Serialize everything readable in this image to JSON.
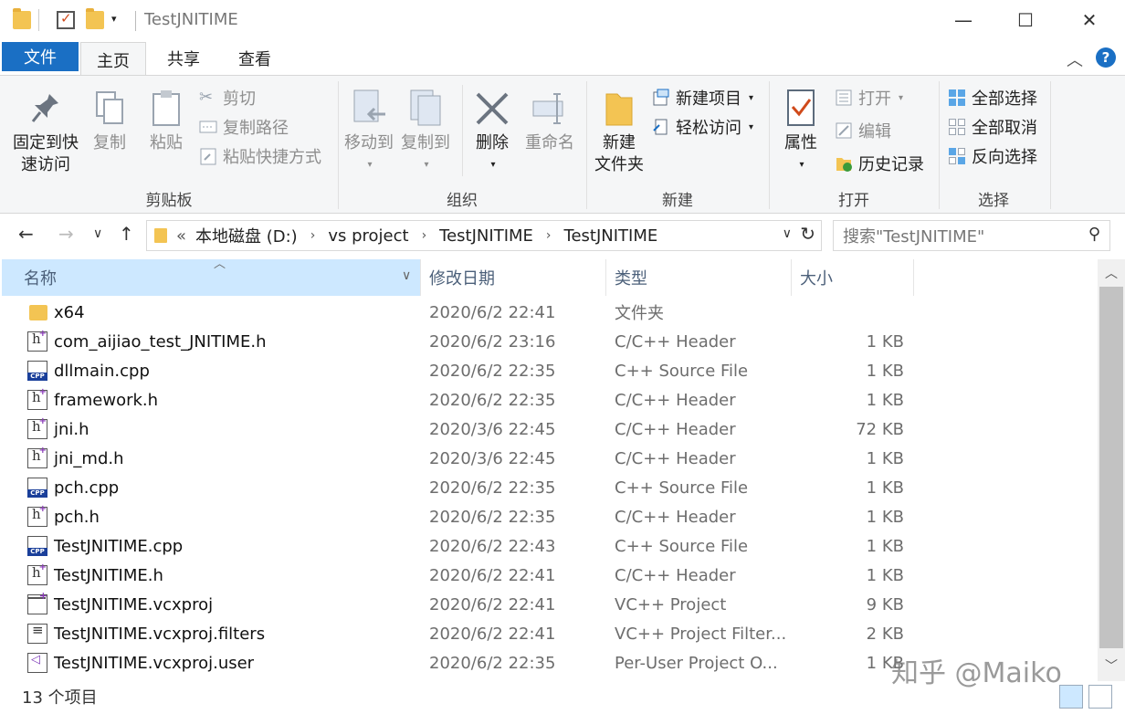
{
  "window": {
    "title": "TestJNITIME",
    "minimize_glyph": "—",
    "maximize_glyph": "☐",
    "close_glyph": "✕"
  },
  "tabs": {
    "file": "文件",
    "home": "主页",
    "share": "共享",
    "view": "查看"
  },
  "ribbon": {
    "clipboard": {
      "label": "剪贴板",
      "pin_line1": "固定到快",
      "pin_line2": "速访问",
      "copy": "复制",
      "paste": "粘贴",
      "cut": "剪切",
      "copy_path": "复制路径",
      "paste_shortcut": "粘贴快捷方式"
    },
    "organize": {
      "label": "组织",
      "move_to": "移动到",
      "copy_to": "复制到",
      "delete": "删除",
      "rename": "重命名"
    },
    "new": {
      "label": "新建",
      "new_folder_line1": "新建",
      "new_folder_line2": "文件夹",
      "new_item": "新建项目",
      "easy_access": "轻松访问"
    },
    "open": {
      "label": "打开",
      "properties": "属性",
      "open": "打开",
      "edit": "编辑",
      "history": "历史记录"
    },
    "select": {
      "label": "选择",
      "select_all": "全部选择",
      "select_none": "全部取消",
      "invert": "反向选择"
    }
  },
  "address": {
    "overflow": "«",
    "crumbs": [
      "本地磁盘 (D:)",
      "vs project",
      "TestJNITIME",
      "TestJNITIME"
    ],
    "search_placeholder": "搜索\"TestJNITIME\""
  },
  "columns": {
    "name": "名称",
    "date": "修改日期",
    "type": "类型",
    "size": "大小"
  },
  "files": [
    {
      "name": "x64",
      "date": "2020/6/2 22:41",
      "type": "文件夹",
      "size": "",
      "icon": "folder-icon"
    },
    {
      "name": "com_aijiao_test_JNITIME.h",
      "date": "2020/6/2 23:16",
      "type": "C/C++ Header",
      "size": "1 KB",
      "icon": "header-file-icon"
    },
    {
      "name": "dllmain.cpp",
      "date": "2020/6/2 22:35",
      "type": "C++ Source File",
      "size": "1 KB",
      "icon": "cpp-file-icon"
    },
    {
      "name": "framework.h",
      "date": "2020/6/2 22:35",
      "type": "C/C++ Header",
      "size": "1 KB",
      "icon": "header-file-icon"
    },
    {
      "name": "jni.h",
      "date": "2020/3/6 22:45",
      "type": "C/C++ Header",
      "size": "72 KB",
      "icon": "header-file-icon"
    },
    {
      "name": "jni_md.h",
      "date": "2020/3/6 22:45",
      "type": "C/C++ Header",
      "size": "1 KB",
      "icon": "header-file-icon"
    },
    {
      "name": "pch.cpp",
      "date": "2020/6/2 22:35",
      "type": "C++ Source File",
      "size": "1 KB",
      "icon": "cpp-file-icon"
    },
    {
      "name": "pch.h",
      "date": "2020/6/2 22:35",
      "type": "C/C++ Header",
      "size": "1 KB",
      "icon": "header-file-icon"
    },
    {
      "name": "TestJNITIME.cpp",
      "date": "2020/6/2 22:43",
      "type": "C++ Source File",
      "size": "1 KB",
      "icon": "cpp-file-icon"
    },
    {
      "name": "TestJNITIME.h",
      "date": "2020/6/2 22:41",
      "type": "C/C++ Header",
      "size": "1 KB",
      "icon": "header-file-icon"
    },
    {
      "name": "TestJNITIME.vcxproj",
      "date": "2020/6/2 22:41",
      "type": "VC++ Project",
      "size": "9 KB",
      "icon": "vcxproj-file-icon"
    },
    {
      "name": "TestJNITIME.vcxproj.filters",
      "date": "2020/6/2 22:41",
      "type": "VC++ Project Filter...",
      "size": "2 KB",
      "icon": "filters-file-icon"
    },
    {
      "name": "TestJNITIME.vcxproj.user",
      "date": "2020/6/2 22:35",
      "type": "Per-User Project O...",
      "size": "1 KB",
      "icon": "user-file-icon"
    }
  ],
  "status": {
    "count": "13 个项目"
  },
  "watermark": "知乎 @Maiko",
  "colors": {
    "accent": "#1a6fc4",
    "selected_header": "#cde8ff",
    "ribbon_bg": "#f5f6f7"
  }
}
